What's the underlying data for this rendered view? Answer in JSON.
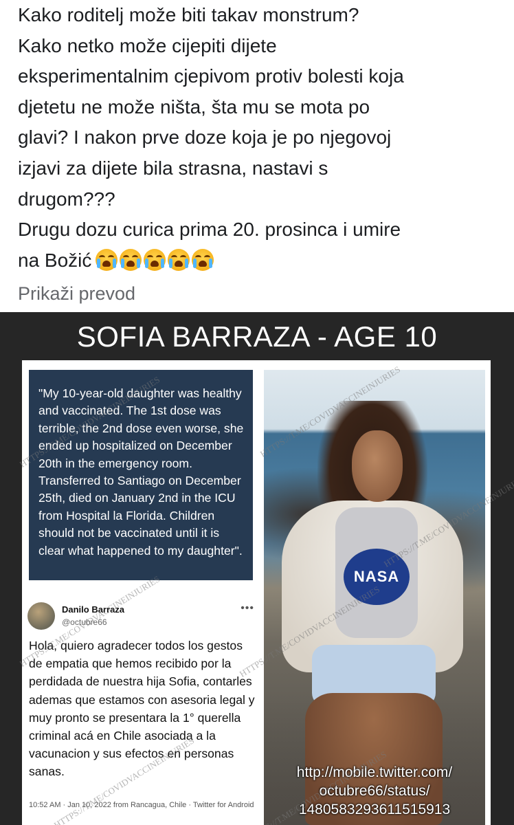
{
  "post": {
    "text_line1": "Kako roditelj može biti takav monstrum?",
    "text_line2": "Kako netko može cijepiti dijete",
    "text_line3": "eksperimentalnim cjepivom protiv bolesti koja",
    "text_line4": "djetetu ne može ništa, šta mu se mota po",
    "text_line5": "glavi? I nakon prve doze koja je po njegovoj",
    "text_line6": "izjavi za dijete bila strasna, nastavi s",
    "text_line7": "drugom???",
    "text_line8": "Drugu dozu curica prima 20. prosinca i umire",
    "text_line9": "na Božić",
    "emoji_icon": "loudly-crying-face-emoji",
    "emoji_count": 5,
    "translate_label": "Prikaži prevod"
  },
  "image": {
    "headline": "SOFIA BARRAZA - AGE 10",
    "quote": "\"My 10-year-old daughter was healthy and vaccinated. The 1st dose was terrible, the 2nd dose even worse, she ended up hospitalized on December 20th in the emergency room. Transferred to Santiago on December 25th, died on January 2nd in the ICU from Hospital la Florida. Children should not be vaccinated until it is clear what happened to my daughter\".",
    "tweet": {
      "name": "Danilo Barraza",
      "handle": "@octubre66",
      "more": "•••",
      "body": "Hola, quiero agradecer todos los gestos de empatia que hemos recibido por la perdidada de nuestra hija Sofia, contarles ademas que estamos con asesoria legal y muy pronto se presentara la 1° querella criminal acá en Chile asociada a la vacunacion y sus efectos en personas sanas.",
      "meta": "10:52 AM · Jan 10, 2022 from Rancagua, Chile · Twitter for Android"
    },
    "photo_url_line1": "http://mobile.twitter.com/",
    "photo_url_line2": "octubre66/status/",
    "photo_url_line3": "1480583293611515913",
    "photo_logo": "NASA",
    "watermark": "HTTPS://T.ME/COVIDVACCINEINJURIES"
  }
}
